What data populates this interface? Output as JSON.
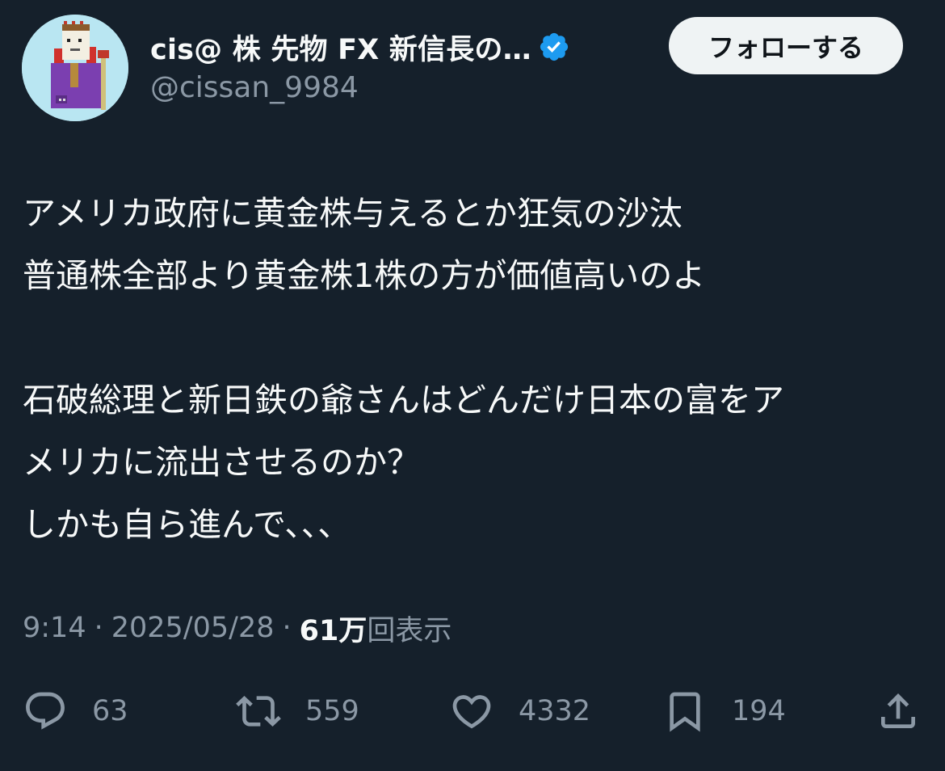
{
  "author": {
    "display_name": "cis@ 株 先物 FX 新信長の…",
    "handle": "@cissan_9984",
    "verified": true,
    "verified_color": "#1d9bf0"
  },
  "follow_button": {
    "label": "フォローする"
  },
  "tweet": {
    "lines": [
      "アメリカ政府に黄金株与えるとか狂気の沙汰",
      "普通株全部より黄金株1株の方が価値高いのよ",
      "",
      "石破総理と新日鉄の爺さんはどんだけ日本の富をア",
      "メリカに流出させるのか？",
      "しかも自ら進んで、、、"
    ]
  },
  "meta": {
    "time": "9:14",
    "separator": "·",
    "date": "2025/05/28",
    "views_count": "61万",
    "views_label": "回表示"
  },
  "actions": {
    "reply_count": "63",
    "retweet_count": "559",
    "like_count": "4332",
    "bookmark_count": "194"
  },
  "colors": {
    "background": "#15202b",
    "text": "#f7f9f9",
    "muted": "#8b98a5",
    "accent": "#1d9bf0"
  }
}
